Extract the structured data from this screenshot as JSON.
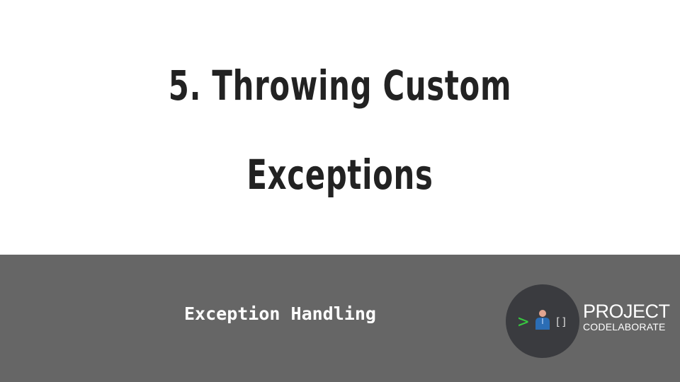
{
  "slide": {
    "title": "5. Throwing Custom Exceptions",
    "subtitle": "Exception Handling"
  },
  "logo": {
    "line1": "PROJECT",
    "line2": "CODELABORATE",
    "icon_prompt": ">",
    "icon_brackets": "[]"
  },
  "colors": {
    "background": "#ffffff",
    "title_text": "#222222",
    "footer_band": "#666666",
    "logo_circle": "#3a3b3f",
    "prompt_green": "#38c840",
    "person_blue": "#2b6db5",
    "person_head": "#e2a48f"
  }
}
